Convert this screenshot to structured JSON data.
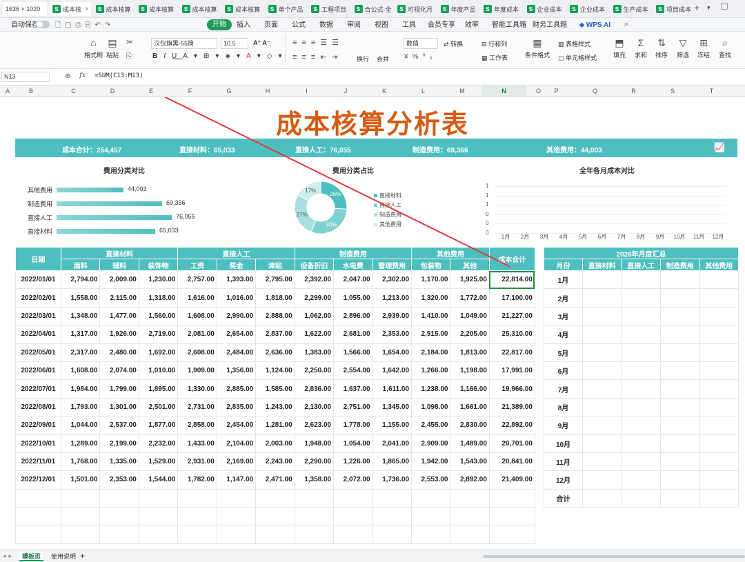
{
  "window": {
    "size_label": "1636 × 1020",
    "tabs": [
      "成本核",
      "成本核算",
      "成本核算",
      "成本核算",
      "成本核算",
      "单个产品",
      "工程项目",
      "合公式-全",
      "可视化月",
      "年度产品",
      "年度成本",
      "企业成本",
      "企业成本",
      "生产成本",
      "项目成本"
    ],
    "new_tab": "+"
  },
  "menu": {
    "autosave": "自动保存",
    "items": [
      "开始",
      "插入",
      "页面",
      "公式",
      "数据",
      "审阅",
      "视图",
      "工具",
      "会员专享",
      "效率",
      "智能工具箱",
      "财务工具箱"
    ],
    "wps_ai": "WPS AI"
  },
  "ribbon": {
    "format_painter": "格式刷",
    "paste": "粘贴",
    "font_name": "汉仪旗黑-55简",
    "font_size": "10.5",
    "number_format": "数值",
    "convert": "转换",
    "row_col": "行和列",
    "worksheet": "工作表",
    "cond_format": "条件格式",
    "table_style": "表格样式",
    "cell_style": "单元格样式",
    "fill": "填充",
    "sum": "求和",
    "sort": "排序",
    "filter": "筛选",
    "freeze": "冻结",
    "find": "查找",
    "wrap": "换行",
    "merge": "合并"
  },
  "formula_bar": {
    "cell_ref": "N13",
    "fx": "fx",
    "formula": "=SUM(C13:M13)"
  },
  "columns": [
    "A",
    "B",
    "C",
    "D",
    "E",
    "F",
    "G",
    "H",
    "I",
    "J",
    "K",
    "L",
    "M",
    "N",
    "O",
    "P",
    "Q",
    "R",
    "S",
    "T"
  ],
  "active_column": "N",
  "title": "成本核算分析表",
  "summary": [
    {
      "label": "成本合计：",
      "value": "254,457"
    },
    {
      "label": "直接材料：",
      "value": "65,033"
    },
    {
      "label": "直接人工：",
      "value": "76,055"
    },
    {
      "label": "制造费用：",
      "value": "69,366"
    },
    {
      "label": "其他费用：",
      "value": "44,003"
    }
  ],
  "charts": {
    "bar": {
      "title": "费用分类对比",
      "items": [
        {
          "label": "其他费用",
          "value": 44003,
          "text": "44,003"
        },
        {
          "label": "制造费用",
          "value": 69366,
          "text": "69,366"
        },
        {
          "label": "直接人工",
          "value": 76055,
          "text": "76,055"
        },
        {
          "label": "直接材料",
          "value": 65033,
          "text": "65,033"
        }
      ]
    },
    "donut": {
      "title": "费用分类占比",
      "segments": [
        {
          "label": "直接材料",
          "pct": 26,
          "text": "26%",
          "color": "#4ebfc0"
        },
        {
          "label": "直接人工",
          "pct": 30,
          "text": "30%",
          "color": "#7fd1d1"
        },
        {
          "label": "制造费用",
          "pct": 27,
          "text": "27%",
          "color": "#a9dfdf"
        },
        {
          "label": "其他费用",
          "pct": 17,
          "text": "17%",
          "color": "#cdeeee"
        }
      ]
    },
    "line": {
      "title": "全年各月成本对比",
      "months": [
        "1月",
        "2月",
        "3月",
        "4月",
        "5月",
        "6月",
        "7月",
        "8月",
        "9月",
        "10月",
        "11月",
        "12月"
      ],
      "yticks": [
        "1",
        "1",
        "1",
        "0",
        "0",
        "0"
      ]
    }
  },
  "chart_data": [
    {
      "type": "bar",
      "title": "费用分类对比",
      "categories": [
        "其他费用",
        "制造费用",
        "直接人工",
        "直接材料"
      ],
      "values": [
        44003,
        69366,
        76055,
        65033
      ]
    },
    {
      "type": "pie",
      "title": "费用分类占比",
      "categories": [
        "直接材料",
        "直接人工",
        "制造费用",
        "其他费用"
      ],
      "values": [
        26,
        30,
        27,
        17
      ]
    },
    {
      "type": "line",
      "title": "全年各月成本对比",
      "categories": [
        "1月",
        "2月",
        "3月",
        "4月",
        "5月",
        "6月",
        "7月",
        "8月",
        "9月",
        "10月",
        "11月",
        "12月"
      ],
      "yticks": [
        "1",
        "1",
        "1",
        "0",
        "0",
        "0"
      ]
    }
  ],
  "main_table": {
    "h_date": "日期",
    "h_total": "成本合计",
    "groups": [
      {
        "label": "直接材料",
        "span": 3
      },
      {
        "label": "直接人工",
        "span": 3
      },
      {
        "label": "制造费用",
        "span": 3
      },
      {
        "label": "其他费用",
        "span": 2
      }
    ],
    "subheaders": [
      "面料",
      "辅料",
      "装饰物",
      "工资",
      "奖金",
      "津贴",
      "设备折旧",
      "水电费",
      "管理费用",
      "包装物",
      "其他"
    ],
    "rows": [
      [
        "2022/01/01",
        "2,794.00",
        "2,009.00",
        "1,230.00",
        "2,757.00",
        "1,393.00",
        "2,795.00",
        "2,392.00",
        "2,047.00",
        "2,302.00",
        "1,170.00",
        "1,925.00",
        "22,814.00"
      ],
      [
        "2022/02/01",
        "1,558.00",
        "2,115.00",
        "1,318.00",
        "1,616.00",
        "1,016.00",
        "1,818.00",
        "2,299.00",
        "1,055.00",
        "1,213.00",
        "1,320.00",
        "1,772.00",
        "17,100.00"
      ],
      [
        "2022/03/01",
        "1,348.00",
        "1,477.00",
        "1,560.00",
        "1,608.00",
        "2,990.00",
        "2,888.00",
        "1,062.00",
        "2,896.00",
        "2,939.00",
        "1,410.00",
        "1,049.00",
        "21,227.00"
      ],
      [
        "2022/04/01",
        "1,317.00",
        "1,926.00",
        "2,719.00",
        "2,081.00",
        "2,654.00",
        "2,837.00",
        "1,622.00",
        "2,681.00",
        "2,353.00",
        "2,915.00",
        "2,205.00",
        "25,310.00"
      ],
      [
        "2022/05/01",
        "2,317.00",
        "2,480.00",
        "1,692.00",
        "2,608.00",
        "2,484.00",
        "2,636.00",
        "1,383.00",
        "1,566.00",
        "1,654.00",
        "2,184.00",
        "1,813.00",
        "22,817.00"
      ],
      [
        "2022/06/01",
        "1,608.00",
        "2,074.00",
        "1,010.00",
        "1,909.00",
        "1,356.00",
        "1,124.00",
        "2,250.00",
        "2,554.00",
        "1,642.00",
        "1,266.00",
        "1,198.00",
        "17,991.00"
      ],
      [
        "2022/07/01",
        "1,984.00",
        "1,799.00",
        "1,895.00",
        "1,330.00",
        "2,885.00",
        "1,585.00",
        "2,836.00",
        "1,637.00",
        "1,611.00",
        "1,238.00",
        "1,166.00",
        "19,966.00"
      ],
      [
        "2022/08/01",
        "1,793.00",
        "1,301.00",
        "2,501.00",
        "2,731.00",
        "2,835.00",
        "1,243.00",
        "2,130.00",
        "2,751.00",
        "1,345.00",
        "1,098.00",
        "1,661.00",
        "21,389.00"
      ],
      [
        "2022/09/01",
        "1,044.00",
        "2,537.00",
        "1,877.00",
        "2,858.00",
        "2,454.00",
        "1,281.00",
        "2,623.00",
        "1,778.00",
        "1,155.00",
        "2,455.00",
        "2,830.00",
        "22,892.00"
      ],
      [
        "2022/10/01",
        "1,289.00",
        "2,199.00",
        "2,232.00",
        "1,433.00",
        "2,104.00",
        "2,003.00",
        "1,948.00",
        "1,054.00",
        "2,041.00",
        "2,909.00",
        "1,489.00",
        "20,701.00"
      ],
      [
        "2022/11/01",
        "1,768.00",
        "1,335.00",
        "1,529.00",
        "2,931.00",
        "2,169.00",
        "2,243.00",
        "2,290.00",
        "1,226.00",
        "1,865.00",
        "1,942.00",
        "1,543.00",
        "20,841.00"
      ],
      [
        "2022/12/01",
        "1,501.00",
        "2,353.00",
        "1,544.00",
        "1,782.00",
        "1,147.00",
        "2,471.00",
        "1,358.00",
        "2,072.00",
        "1,736.00",
        "2,553.00",
        "2,892.00",
        "21,409.00"
      ]
    ]
  },
  "side_table": {
    "title": "2026年月度汇总",
    "headers": [
      "月份",
      "直接材料",
      "直接人工",
      "制造费用",
      "其他费用"
    ],
    "months": [
      "1月",
      "2月",
      "3月",
      "4月",
      "5月",
      "6月",
      "7月",
      "8月",
      "9月",
      "10月",
      "11月",
      "12月"
    ],
    "total": "合计"
  },
  "sheets": [
    "模板页",
    "使用说明"
  ],
  "add_sheet": "+"
}
